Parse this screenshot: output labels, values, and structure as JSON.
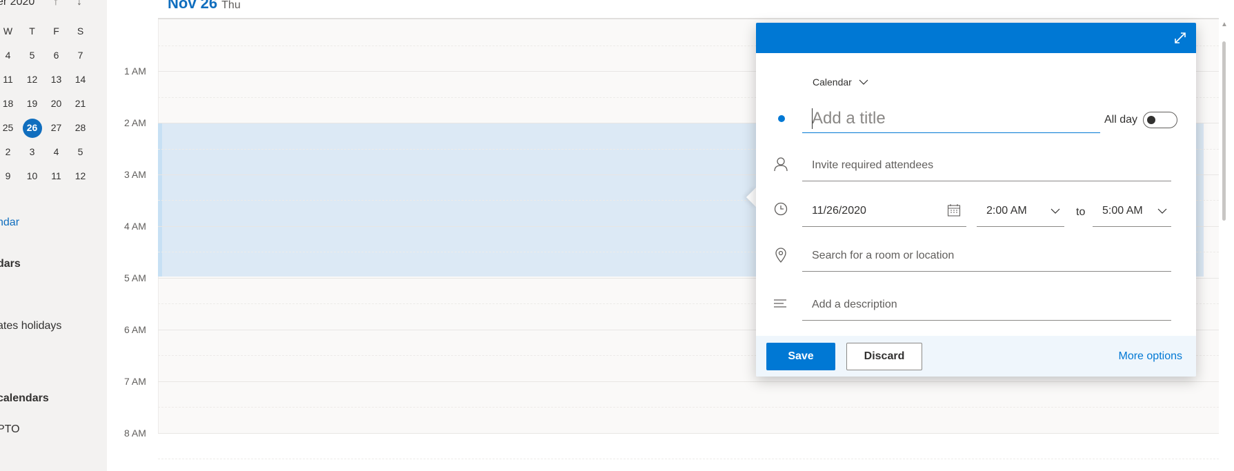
{
  "sidebar": {
    "month_title": "er 2020",
    "up_arrow": "↑",
    "down_arrow": "↓",
    "weekday_headers": [
      "W",
      "T",
      "F",
      "S"
    ],
    "weeks": [
      [
        "4",
        "5",
        "6",
        "7"
      ],
      [
        "11",
        "12",
        "13",
        "14"
      ],
      [
        "18",
        "19",
        "20",
        "21"
      ],
      [
        "25",
        "26",
        "27",
        "28"
      ],
      [
        "2",
        "3",
        "4",
        "5"
      ],
      [
        "9",
        "10",
        "11",
        "12"
      ]
    ],
    "today": "26",
    "calendar_link": "ndar",
    "calendars_heading": "dars",
    "holidays_item": "ates holidays",
    "other_calendars_heading": "calendars",
    "pto_item": "PTO"
  },
  "day_view": {
    "date": "Nov 26",
    "weekday": "Thu",
    "hours": [
      "1 AM",
      "2 AM",
      "3 AM",
      "4 AM",
      "5 AM",
      "6 AM",
      "7 AM",
      "8 AM"
    ]
  },
  "popup": {
    "calendar_select": "Calendar",
    "title_placeholder": "Add a title",
    "all_day_label": "All day",
    "all_day_on": false,
    "attendees_placeholder": "Invite required attendees",
    "date_value": "11/26/2020",
    "start_time": "2:00 AM",
    "to_label": "to",
    "end_time": "5:00 AM",
    "location_placeholder": "Search for a room or location",
    "description_placeholder": "Add a description",
    "save_label": "Save",
    "discard_label": "Discard",
    "more_options_label": "More options"
  },
  "colors": {
    "accent": "#0078d4",
    "selection": "#dce9f5"
  },
  "icons": {
    "expand": "expand-icon",
    "person": "person-icon",
    "clock": "clock-icon",
    "location": "location-pin-icon",
    "description": "text-lines-icon",
    "calendar_picker": "calendar-icon",
    "chevron": "chevron-down-icon"
  }
}
